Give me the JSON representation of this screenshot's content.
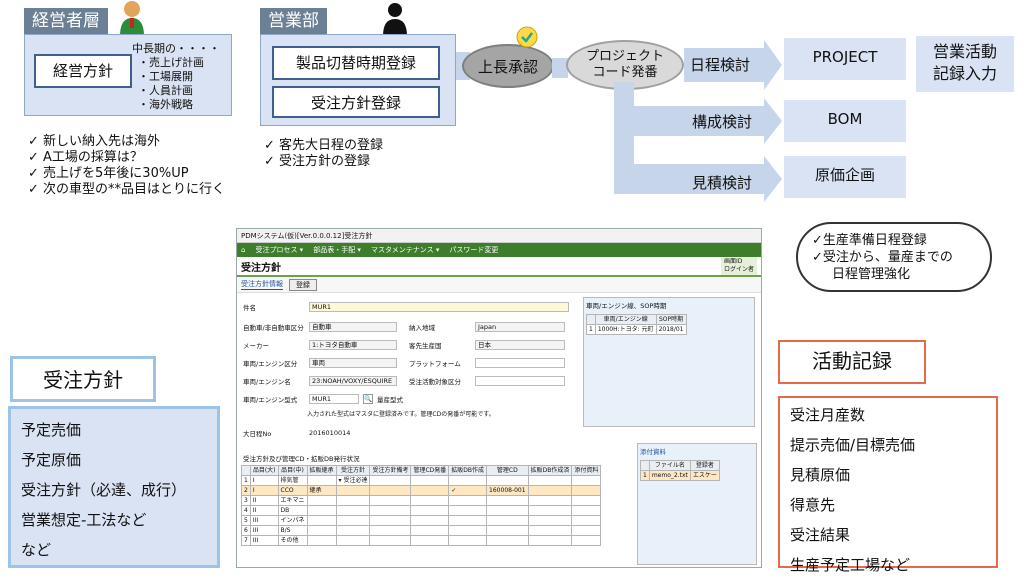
{
  "left_flow": {
    "role": "経営者層",
    "box": "経営方針",
    "notes": [
      "中長期の・・・・",
      "・売上げ計画",
      "・工場展開",
      "・人員計画",
      "・海外戦略"
    ],
    "bullets": [
      "✓ 新しい納入先は海外",
      "✓ A工場の採算は？",
      "✓ 売上げを5年後に30%UP",
      "✓ 次の車型の**品目はとりに行く"
    ]
  },
  "sales": {
    "role": "営業部",
    "boxes": [
      "製品切替時期登録",
      "受注方針登録"
    ],
    "bullets": [
      "✓ 客先大日程の登録",
      "✓ 受注方針の登録"
    ]
  },
  "approval": "上長承認",
  "project_code": [
    "プロジェクト",
    "コード発番"
  ],
  "branches": [
    {
      "label": "日程検討",
      "out": "PROJECT"
    },
    {
      "label": "構成検討",
      "out": "BOM"
    },
    {
      "label": "見積検討",
      "out": "原価企画"
    }
  ],
  "sales_record": [
    "営業活動",
    "記録入力"
  ],
  "cloud": [
    "✓生産準備日程登録",
    "✓受注から、量産までの",
    "日程管理強化"
  ],
  "policy": {
    "title": "受注方針",
    "items": [
      "予定売価",
      "予定原価",
      "受注方針（必達、成行）",
      "営業想定-工法など",
      "など"
    ]
  },
  "activity": {
    "title": "活動記録",
    "items": [
      "受注月産数",
      "提示売価/目標売価",
      "見積原価",
      "得意先",
      "受注結果",
      "生産予定工場など"
    ]
  },
  "app": {
    "window_title": "PDMシステム(仮)[Ver.0.0.0.12]受注方針",
    "menu": [
      "受注プロセス ▾",
      "部品表・手配 ▾",
      "マスタメンテナンス ▾",
      "パスワード変更"
    ],
    "page_title": "受注方針",
    "head_right": [
      "画面ID",
      "ログイン者"
    ],
    "tab": "受注方針情報",
    "register_btn": "登録",
    "fields": {
      "name_label": "件名",
      "name_val": "MUR1",
      "kind_label": "自動車/非自動車区分",
      "kind_val": "自動車",
      "maker_label": "メーカー",
      "maker_val": "1:トヨタ自動車",
      "car_label": "車両/エンジン区分",
      "car_val": "車両",
      "car_name_label": "車両/エンジン名",
      "car_name_val": "23:NOAH/VOXY/ESQUIRE",
      "model_label": "車両/エンジン型式",
      "model_val": "MUR1",
      "model_btn": "量産型式",
      "dest_label": "納入地域",
      "dest_val": "Japan",
      "cust_label": "客先生産国",
      "cust_val": "日本",
      "platform_label": "プラットフォーム",
      "target_label": "受注活動対象区分",
      "note": "入力された型式はマスタに登録済みです。管理CDの発番が可能です。",
      "date_label": "大日程No",
      "date_val": "2016010014"
    },
    "sop": {
      "title": "車両/エンジン線、SOP時期",
      "headers": [
        "車両/エンジン線",
        "SOP時期"
      ],
      "row": [
        "1",
        "1000H:トヨタ: 元町",
        "2018/01"
      ]
    },
    "grid_title": "受注方針及び管理CD・拡販DB発行状況",
    "grid_headers": [
      "品目(大)",
      "品目(中)",
      "拡販継承",
      "受注方針",
      "受注方針備考",
      "管理CD発番",
      "拡販DB作成",
      "管理CD",
      "拡販DB作成済",
      "添付資料"
    ],
    "grid_rows": [
      [
        "1",
        "I",
        "排気管",
        "",
        "▾ 受注必達",
        "",
        "",
        "",
        "",
        "",
        ""
      ],
      [
        "2",
        "I",
        "CCO",
        "継承",
        "",
        "",
        "",
        "✓",
        "160008-001",
        "",
        ""
      ],
      [
        "3",
        "II",
        "エキマニ",
        "",
        "",
        "",
        "",
        "",
        "",
        "",
        ""
      ],
      [
        "4",
        "II",
        "DB",
        "",
        "",
        "",
        "",
        "",
        "",
        "",
        ""
      ],
      [
        "5",
        "III",
        "インパネ",
        "",
        "",
        "",
        "",
        "",
        "",
        "",
        ""
      ],
      [
        "6",
        "III",
        "B/S",
        "",
        "",
        "",
        "",
        "",
        "",
        "",
        ""
      ],
      [
        "7",
        "III",
        "その他",
        "",
        "",
        "",
        "",
        "",
        "",
        "",
        ""
      ]
    ],
    "attach": {
      "title": "添付資料",
      "headers": [
        "ファイル名",
        "登録者"
      ],
      "row": [
        "1",
        "memo_2.txt",
        "エスケー"
      ]
    }
  }
}
